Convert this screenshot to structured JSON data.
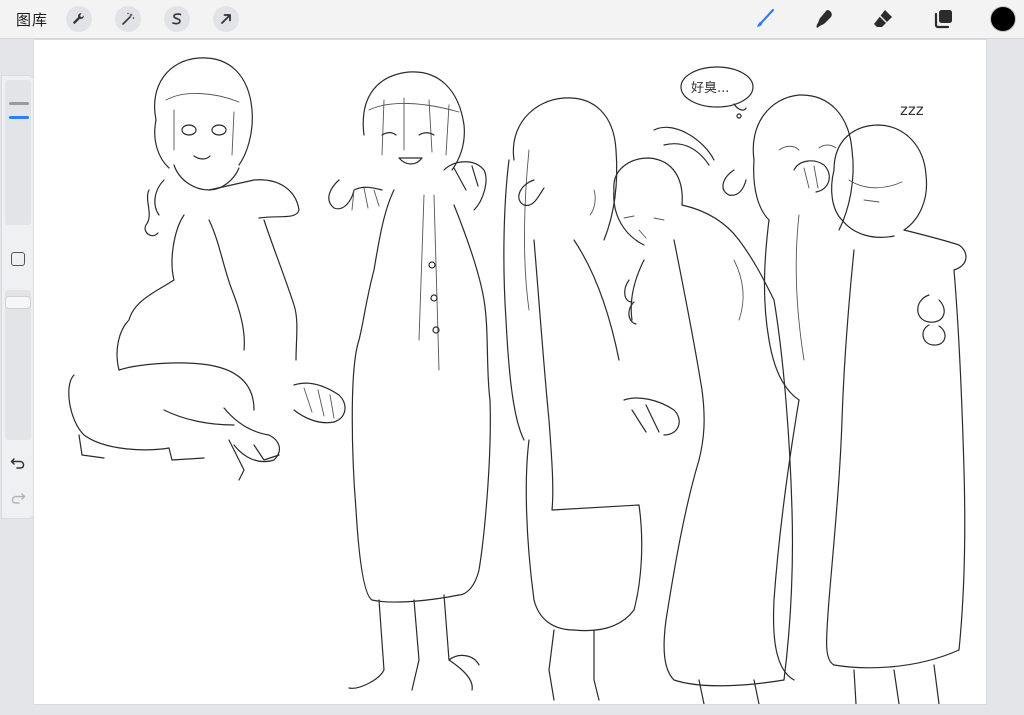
{
  "topbar": {
    "gallery_label": "图库",
    "left_tools": [
      {
        "name": "actions",
        "icon": "wrench-icon"
      },
      {
        "name": "adjustments",
        "icon": "magic-wand-icon"
      },
      {
        "name": "selection",
        "icon": "selection-s-icon"
      },
      {
        "name": "transform",
        "icon": "arrow-cursor-icon"
      }
    ],
    "right_tools": [
      {
        "name": "brush",
        "icon": "brush-icon",
        "active": true
      },
      {
        "name": "smudge",
        "icon": "smudge-icon",
        "active": false
      },
      {
        "name": "eraser",
        "icon": "eraser-icon",
        "active": false
      },
      {
        "name": "layers",
        "icon": "layers-icon",
        "active": false
      }
    ],
    "current_color": "#000000"
  },
  "sidebar": {
    "brush_size_level": 0.88,
    "opacity_level": 0.97,
    "modify_button_icon": "square-icon",
    "undo_icon": "undo-icon",
    "redo_icon": "redo-icon",
    "redo_enabled": false
  },
  "canvas": {
    "speech_bubble_text": "好臭...",
    "sleep_text": "zzz",
    "accent_color": "#2f7df6"
  }
}
